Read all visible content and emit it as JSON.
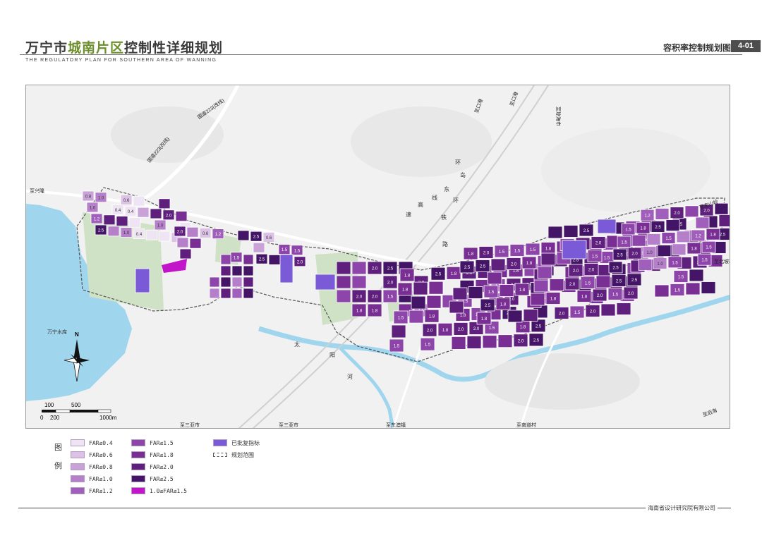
{
  "header": {
    "title_prefix": "万宁市",
    "title_highlight": "城南片区",
    "title_suffix": "控制性详细规划",
    "subtitle_en": "THE REGULATORY PLAN FOR SOUTHERN AREA OF WANNING",
    "sheet_title": "容积率控制规划图",
    "sheet_code": "4-01"
  },
  "map": {
    "direction_labels": {
      "to_xinglong": "至兴隆",
      "to_qionghai": "至琼海市",
      "to_dongshan": "至东山岭",
      "to_beipo": "至北坡村",
      "to_houhai": "至后海",
      "to_nanli": "至南道村",
      "to_dongao": "至东澳镇",
      "to_sanya_1": "至三亚市",
      "to_sanya_2": "至三亚市",
      "to_gangkou_1": "至口港",
      "to_gangkou_2": "至口港",
      "to_g223": "国道223(改线)"
    },
    "road_labels": {
      "ring_island_expressway": [
        "环",
        "岛",
        "东",
        "环",
        "高",
        "速",
        "铁",
        "路",
        "线"
      ],
      "national_road": "国道223(改线)",
      "taiyang_river": [
        "太",
        "阳",
        "河"
      ]
    },
    "water_label": "万宁水库",
    "north_label": "N",
    "scale": {
      "ticks_top": [
        "100",
        "500"
      ],
      "ticks_bottom": [
        "0",
        "200",
        "1000m"
      ]
    },
    "parcel_values": [
      "1.5",
      "1.8",
      "2.0",
      "2.5",
      "1.2",
      "1.0",
      "0.8",
      "0.6",
      "0.4"
    ],
    "colors": {
      "far_04": "#efe4f3",
      "far_06": "#dcc3e6",
      "far_08": "#c9a2d8",
      "far_10": "#b57fca",
      "far_12": "#a05fbb",
      "far_15": "#8e45aa",
      "far_18": "#782e93",
      "far_20": "#5f1f7d",
      "far_25": "#441466",
      "far_mix": "#c214c8",
      "approved": "#7a5ad6",
      "green": "#cfe2c6",
      "water": "#9fd6ee"
    }
  },
  "legend": {
    "title": [
      "图",
      "例"
    ],
    "items": [
      {
        "label": "FAR≤0.4",
        "color": "#efe4f3"
      },
      {
        "label": "FAR≤0.6",
        "color": "#dcc3e6"
      },
      {
        "label": "FAR≤0.8",
        "color": "#c9a2d8"
      },
      {
        "label": "FAR≤1.0",
        "color": "#b57fca"
      },
      {
        "label": "FAR≤1.2",
        "color": "#a05fbb"
      },
      {
        "label": "FAR≤1.5",
        "color": "#8e45aa"
      },
      {
        "label": "FAR≤1.8",
        "color": "#782e93"
      },
      {
        "label": "FAR≤2.0",
        "color": "#5f1f7d"
      },
      {
        "label": "FAR≤2.5",
        "color": "#441466"
      },
      {
        "label": "1.0≤FAR≤1.5",
        "color": "#c214c8"
      },
      {
        "label": "已批复指标",
        "color": "#7a5ad6"
      },
      {
        "label": "规划范围",
        "color": "#ffffff"
      }
    ]
  },
  "footer": {
    "organization": "海南省设计研究院有限公司"
  }
}
